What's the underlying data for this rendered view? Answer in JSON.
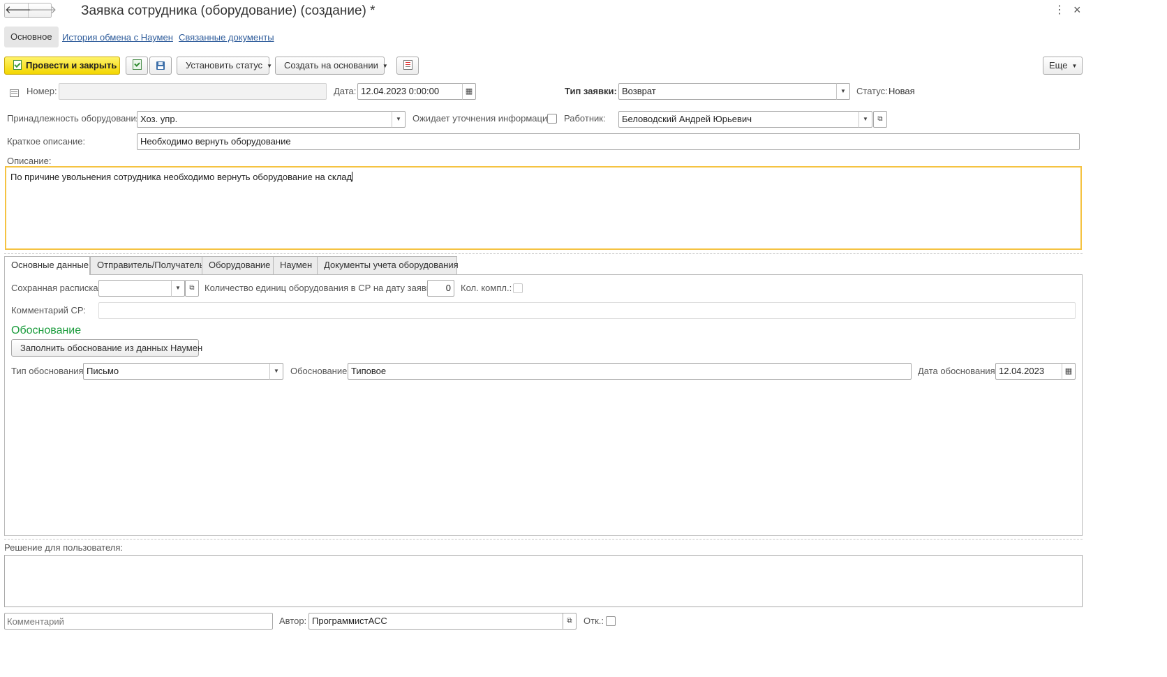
{
  "window": {
    "title": "Заявка сотрудника (оборудование) (создание) *",
    "back_glyph": "🡐",
    "forward_glyph": "🡒",
    "more_glyph": "⋮",
    "close_glyph": "×"
  },
  "nav_tabs": [
    {
      "label": "Основное",
      "active": true
    },
    {
      "label": "История обмена с Наумен",
      "active": false
    },
    {
      "label": "Связанные документы",
      "active": false
    }
  ],
  "toolbar": {
    "post_and_close": "Провести и закрыть",
    "set_status": "Установить статус",
    "create_based_on": "Создать на основании",
    "more": "Еще"
  },
  "header": {
    "number_label": "Номер:",
    "number_value": "",
    "date_label": "Дата:",
    "date_value": "12.04.2023  0:00:00",
    "request_type_label": "Тип заявки:",
    "request_type_value": "Возврат",
    "status_label": "Статус:",
    "status_value": "Новая",
    "ownership_label": "Принадлежность оборудования:",
    "ownership_value": "Хоз. упр.",
    "awaiting_info_label": "Ожидает уточнения информации:",
    "employee_label": "Работник:",
    "employee_value": "Беловодский Андрей Юрьевич",
    "short_desc_label": "Краткое описание:",
    "short_desc_value": "Необходимо вернуть оборудование",
    "description_label": "Описание:",
    "description_value": "По причине увольнения сотрудника необходимо вернуть оборудование на склад"
  },
  "tabs": [
    {
      "label": "Основные данные",
      "active": true
    },
    {
      "label": "Отправитель/Получатель",
      "active": false
    },
    {
      "label": "Оборудование",
      "active": false
    },
    {
      "label": "Наумен",
      "active": false
    },
    {
      "label": "Документы учета оборудования",
      "active": false
    }
  ],
  "main_tab": {
    "receipt_label": "Сохранная расписка:",
    "receipt_value": "",
    "units_count_label": "Количество единиц оборудования в СР на дату заявки:",
    "units_count_value": "0",
    "kit_count_label": "Кол. компл.:",
    "cr_comment_label": "Комментарий СР:",
    "cr_comment_value": "",
    "justification_heading": "Обоснование",
    "fill_button": "Заполнить обоснование из данных Наумен",
    "justification_type_label": "Тип обоснования:",
    "justification_type_value": "Письмо",
    "justification_label": "Обоснование:",
    "justification_value": "Типовое",
    "justification_date_label": "Дата обоснования:",
    "justification_date_value": "12.04.2023"
  },
  "footer": {
    "decision_label": "Решение для пользователя:",
    "decision_value": "",
    "comment_placeholder": "Комментарий",
    "author_label": "Автор:",
    "author_value": "ПрограммистАСС",
    "rejected_label": "Отк.:"
  },
  "colors": {
    "accent_yellow": "#f3d600",
    "focus_border": "#f5c342",
    "link_blue": "#2d5b9a",
    "heading_green": "#1a9c3c"
  }
}
